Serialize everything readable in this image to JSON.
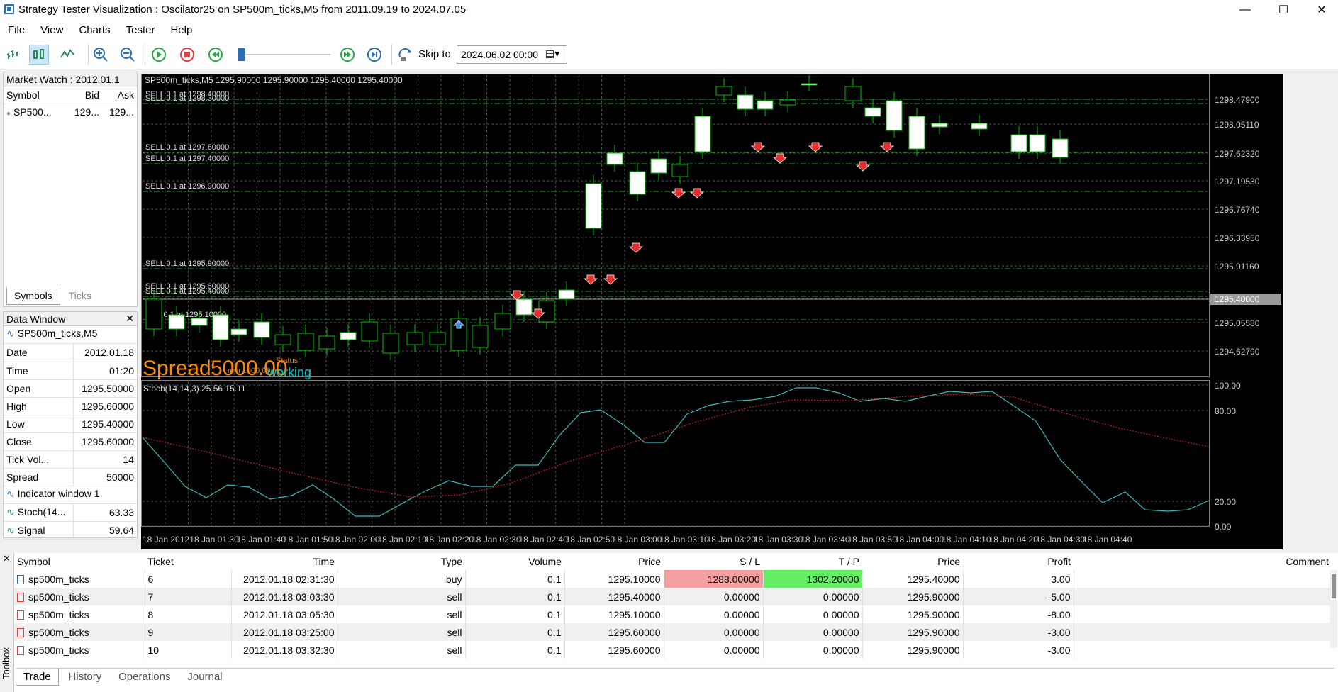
{
  "window": {
    "title": "Strategy Tester Visualization : Oscilator25 on SP500m_ticks,M5 from 2011.09.19 to 2024.07.05"
  },
  "menu": [
    "File",
    "View",
    "Charts",
    "Tester",
    "Help"
  ],
  "toolbar": {
    "skip_label": "Skip to",
    "skip_value": "2024.06.02 00:00"
  },
  "market_watch": {
    "title": "Market Watch : 2012.01.1",
    "columns": [
      "Symbol",
      "Bid",
      "Ask"
    ],
    "row": {
      "symbol": "SP500...",
      "bid": "129...",
      "ask": "129..."
    },
    "tabs": [
      "Symbols",
      "Ticks"
    ]
  },
  "data_window": {
    "title": "Data Window",
    "symbol": "SP500m_ticks,M5",
    "rows": [
      {
        "label": "Date",
        "value": "2012.01.18"
      },
      {
        "label": "Time",
        "value": "01:20"
      },
      {
        "label": "Open",
        "value": "1295.50000"
      },
      {
        "label": "High",
        "value": "1295.60000"
      },
      {
        "label": "Low",
        "value": "1295.40000"
      },
      {
        "label": "Close",
        "value": "1295.60000"
      },
      {
        "label": "Tick Vol...",
        "value": "14"
      },
      {
        "label": "Spread",
        "value": "50000"
      }
    ],
    "indicator_title": "Indicator window 1",
    "ind_rows": [
      {
        "label": "Stoch(14...",
        "value": "63.33"
      },
      {
        "label": "Signal",
        "value": "59.64"
      }
    ]
  },
  "chart": {
    "header": "SP500m_ticks,M5   1295.90000 1295.90000 1295.40000 1295.40000",
    "price_labels": [
      "1298.47900",
      "1298.05110",
      "1297.62320",
      "1297.19530",
      "1296.76740",
      "1296.33950",
      "1295.91160",
      "1295.40000",
      "1295.05580",
      "1294.62790"
    ],
    "current_price": "1295.40000",
    "sell_labels": [
      "SELL 0.1 at 1298.40000",
      "SELL 0.1 at 1298.30000",
      "SELL 0.1 at 1297.60000",
      "SELL 0.1 at 1297.40000",
      "SELL 0.1 at 1296.90000",
      "SELL 0.1 at 1295.90000",
      "SELL 0.1 at 1295.60000",
      "SELL 0.1 at 1295.40000",
      "BUY 0.1 at 1295.10000"
    ],
    "spread_text": "Spread",
    "spread_value": "5000.00",
    "status_text": "Status",
    "working_text": "working",
    "min_text": "min 1000.00",
    "stoch_header": "Stoch(14,14,3) 25.56 15.11",
    "stoch_labels": [
      "100.00",
      "80.00",
      "20.00",
      "0.00"
    ],
    "time_labels": [
      "18 Jan 2012",
      "18 Jan 01:30",
      "18 Jan 01:40",
      "18 Jan 01:50",
      "18 Jan 02:00",
      "18 Jan 02:10",
      "18 Jan 02:20",
      "18 Jan 02:30",
      "18 Jan 02:40",
      "18 Jan 02:50",
      "18 Jan 03:00",
      "18 Jan 03:10",
      "18 Jan 03:20",
      "18 Jan 03:30",
      "18 Jan 03:40",
      "18 Jan 03:50",
      "18 Jan 04:00",
      "18 Jan 04:10",
      "18 Jan 04:20",
      "18 Jan 04:30",
      "18 Jan 04:40"
    ],
    "colors": {
      "bull": "#ffffff",
      "bear": "#000000",
      "frame": "#00c000",
      "stoch": "#3fb8b8",
      "signal": "#c02020",
      "spread": "#ff8c00",
      "working": "#00cccc"
    }
  },
  "trades": {
    "columns": [
      "Symbol",
      "Ticket",
      "Time",
      "Type",
      "Volume",
      "Price",
      "S / L",
      "T / P",
      "Price",
      "Profit",
      "Comment"
    ],
    "rows": [
      {
        "symbol": "sp500m_ticks",
        "ticket": "6",
        "time": "2012.01.18 02:31:30",
        "type": "buy",
        "volume": "0.1",
        "price": "1295.10000",
        "sl": "1288.00000",
        "tp": "1302.20000",
        "cur": "1295.40000",
        "profit": "3.00"
      },
      {
        "symbol": "sp500m_ticks",
        "ticket": "7",
        "time": "2012.01.18 03:03:30",
        "type": "sell",
        "volume": "0.1",
        "price": "1295.40000",
        "sl": "0.00000",
        "tp": "0.00000",
        "cur": "1295.90000",
        "profit": "-5.00"
      },
      {
        "symbol": "sp500m_ticks",
        "ticket": "8",
        "time": "2012.01.18 03:05:30",
        "type": "sell",
        "volume": "0.1",
        "price": "1295.10000",
        "sl": "0.00000",
        "tp": "0.00000",
        "cur": "1295.90000",
        "profit": "-8.00"
      },
      {
        "symbol": "sp500m_ticks",
        "ticket": "9",
        "time": "2012.01.18 03:25:00",
        "type": "sell",
        "volume": "0.1",
        "price": "1295.60000",
        "sl": "0.00000",
        "tp": "0.00000",
        "cur": "1295.90000",
        "profit": "-3.00"
      },
      {
        "symbol": "sp500m_ticks",
        "ticket": "10",
        "time": "2012.01.18 03:32:30",
        "type": "sell",
        "volume": "0.1",
        "price": "1295.60000",
        "sl": "0.00000",
        "tp": "0.00000",
        "cur": "1295.90000",
        "profit": "-3.00"
      }
    ],
    "sl_highlight": "#f4a0a0",
    "tp_highlight": "#66ee66"
  },
  "toolbox": {
    "label": "Toolbox",
    "tabs": [
      "Trade",
      "History",
      "Operations",
      "Journal"
    ]
  }
}
